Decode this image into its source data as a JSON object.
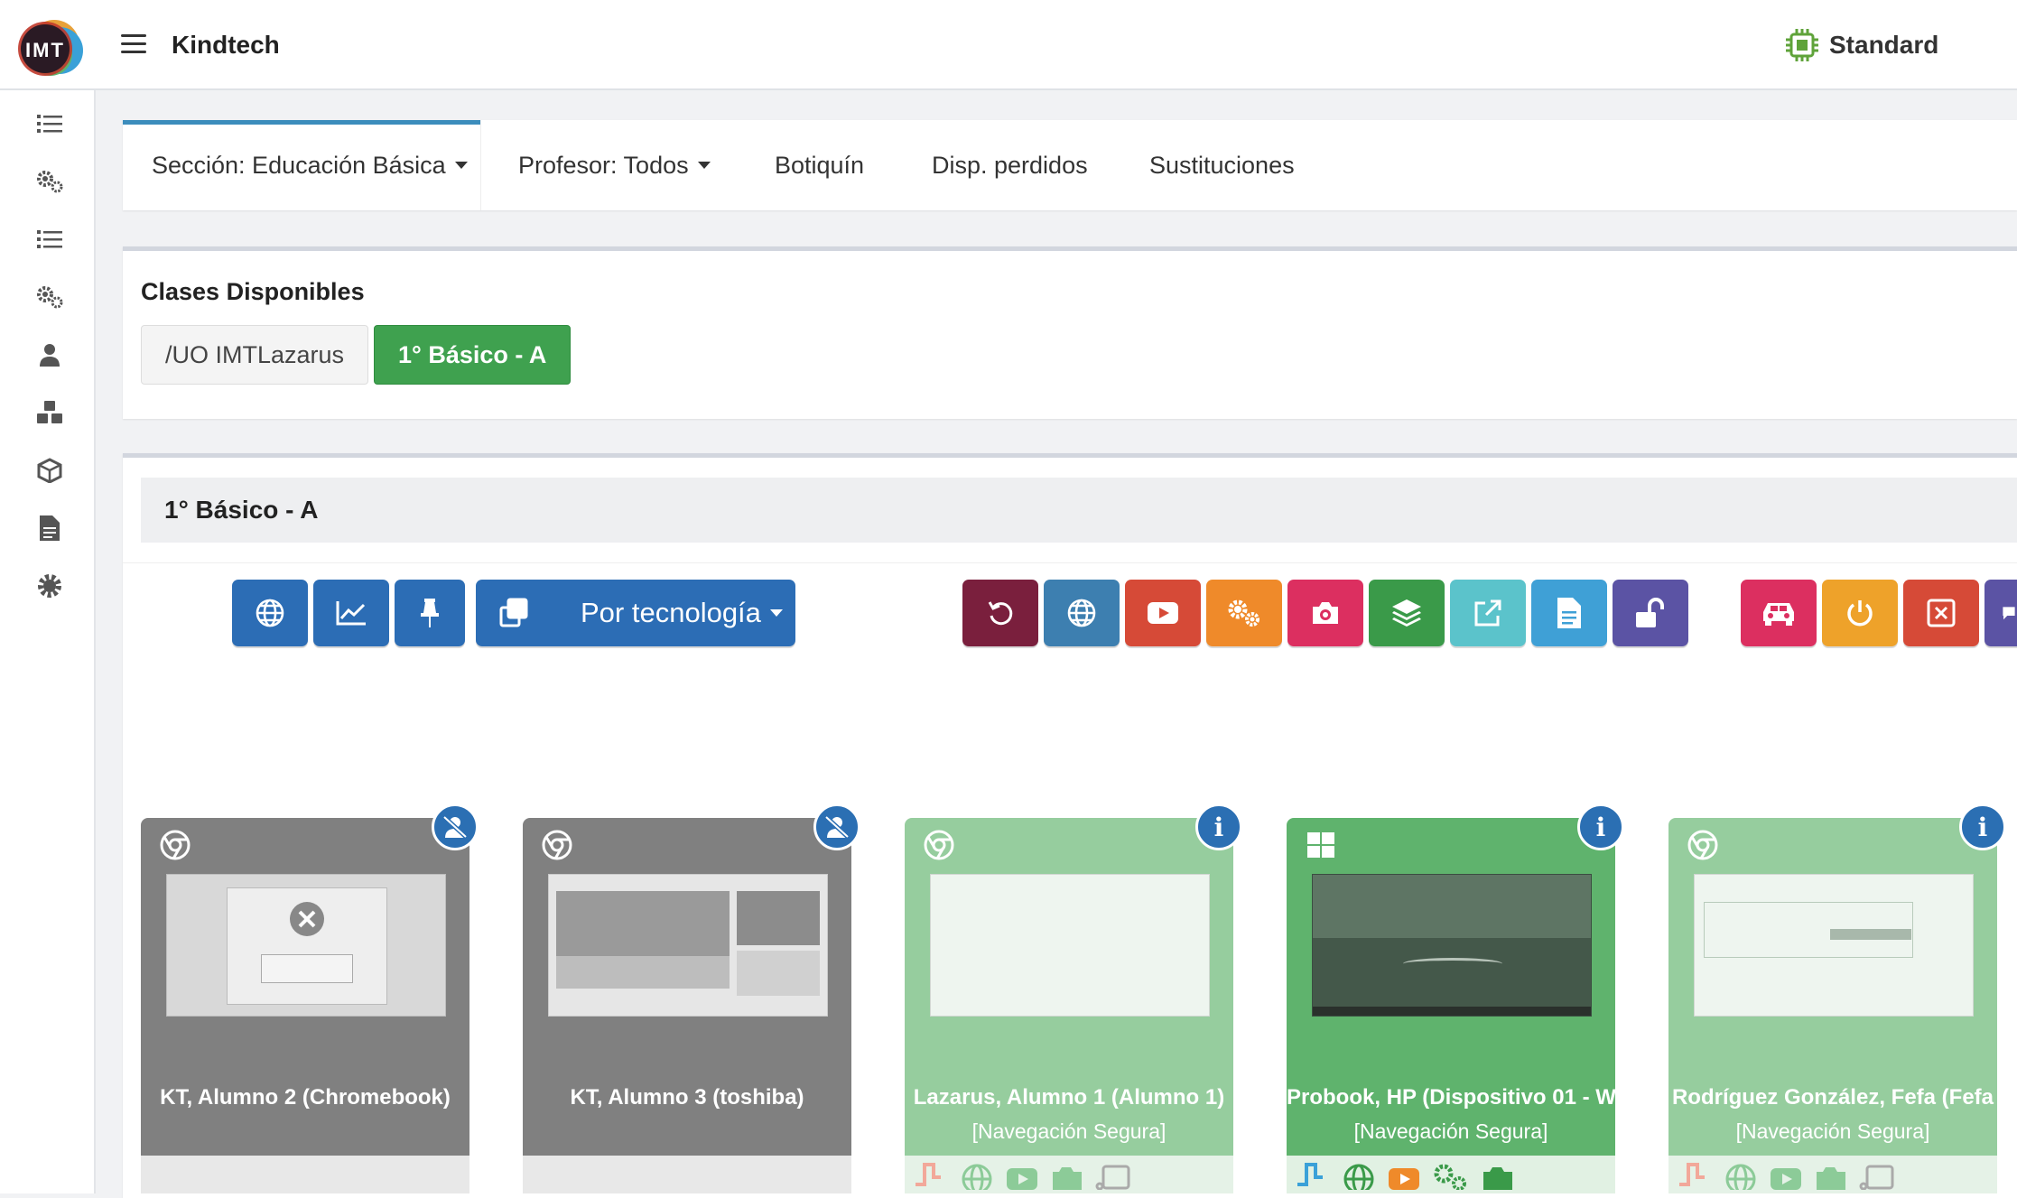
{
  "header": {
    "logo_text": "IMT",
    "brand": "Kindtech",
    "plan_label": "Standard",
    "plan_icon": "chip-icon"
  },
  "sidebar": {
    "items": [
      {
        "icon": "list-icon"
      },
      {
        "icon": "gears-icon"
      },
      {
        "icon": "list-icon"
      },
      {
        "icon": "gears-icon"
      },
      {
        "icon": "user-icon"
      },
      {
        "icon": "cubes-icon"
      },
      {
        "icon": "cube-icon"
      },
      {
        "icon": "file-icon"
      },
      {
        "icon": "cog-icon"
      }
    ]
  },
  "nav": {
    "items": [
      {
        "label": "Sección: Educación Básica",
        "dropdown": true,
        "active": true
      },
      {
        "label": "Profesor: Todos",
        "dropdown": true
      },
      {
        "label": "Botiquín"
      },
      {
        "label": "Disp. perdidos"
      },
      {
        "label": "Sustituciones"
      }
    ]
  },
  "classes": {
    "title": "Clases Disponibles",
    "buttons": [
      "/UO IMTLazarus",
      "1° Básico - A"
    ]
  },
  "section": {
    "title": "1° Básico - A",
    "tech_dropdown_label": "Por tecnología",
    "left_tools": [
      {
        "icon": "globe-icon",
        "color": "#2c6db5"
      },
      {
        "icon": "chart-line-icon",
        "color": "#2c6db5"
      },
      {
        "icon": "pin-icon",
        "color": "#2c6db5"
      },
      {
        "icon": "clone-icon",
        "color": "#2c6db5"
      }
    ],
    "right_tools": [
      {
        "icon": "undo-icon",
        "color": "#7a1f3d"
      },
      {
        "icon": "globe-icon",
        "color": "#3d7fb0"
      },
      {
        "icon": "youtube-icon",
        "color": "#d64a37"
      },
      {
        "icon": "gears-icon",
        "color": "#ef8a2a"
      },
      {
        "icon": "camera-icon",
        "color": "#dc2f60"
      },
      {
        "icon": "layers-icon",
        "color": "#3a9a49"
      },
      {
        "icon": "external-link-icon",
        "color": "#5bc3cb"
      },
      {
        "icon": "document-icon",
        "color": "#3fa0d6"
      },
      {
        "icon": "unlock-icon",
        "color": "#5b53a4"
      },
      {
        "icon": "car-icon",
        "color": "#dc2f60"
      },
      {
        "icon": "power-icon",
        "color": "#eea22a"
      },
      {
        "icon": "close-box-icon",
        "color": "#d64a37"
      },
      {
        "icon": "chat-icon",
        "color": "#5b53a4"
      }
    ]
  },
  "devices": [
    {
      "name": "KT, Alumno 2 (Chromebook)",
      "mode": "",
      "os": "chrome-icon",
      "status": "offline",
      "badge": "user-slash-icon"
    },
    {
      "name": "KT, Alumno 3 (toshiba)",
      "mode": "",
      "os": "chrome-icon",
      "status": "offline",
      "badge": "user-slash-icon"
    },
    {
      "name": "Lazarus, Alumno 1 (Alumno 1)",
      "mode": "[Navegación Segura]",
      "os": "chrome-icon",
      "status": "online",
      "badge": "i"
    },
    {
      "name": "Probook, HP (Dispositivo 01 - W",
      "mode": "[Navegación Segura]",
      "os": "windows-icon",
      "status": "active",
      "badge": "i"
    },
    {
      "name": "Rodríguez González, Fefa (Fefa",
      "mode": "[Navegación Segura]",
      "os": "chrome-icon",
      "status": "online",
      "badge": "i"
    }
  ],
  "colors": {
    "card_offline": "#808080",
    "card_online": "#96cd9e",
    "card_active": "#5fb36d",
    "accent": "#3c8dbc"
  }
}
